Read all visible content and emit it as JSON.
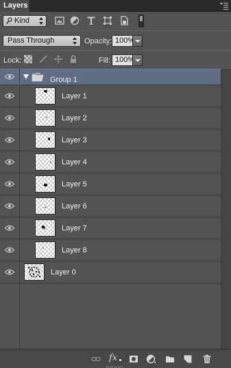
{
  "panel": {
    "tab_label": "Layers",
    "menu_icon": "panel-menu-icon"
  },
  "filter": {
    "kind_label": "Kind",
    "icons": [
      "pixel-layer-filter-icon",
      "adjustment-layer-filter-icon",
      "type-layer-filter-icon",
      "shape-layer-filter-icon",
      "smart-object-filter-icon"
    ]
  },
  "blend": {
    "mode": "Pass Through",
    "opacity_label": "Opacity:",
    "opacity_value": "100%"
  },
  "lock": {
    "label": "Lock:",
    "icons": [
      "lock-transparent-pixels-icon",
      "lock-image-pixels-icon",
      "lock-position-icon",
      "lock-all-icon"
    ],
    "fill_label": "Fill:",
    "fill_value": "100%"
  },
  "layers": {
    "group": {
      "name": "Group 1",
      "visible": true,
      "expanded": true
    },
    "children": [
      {
        "name": "Layer 1",
        "visible": true
      },
      {
        "name": "Layer 2",
        "visible": true
      },
      {
        "name": "Layer 3",
        "visible": true
      },
      {
        "name": "Layer 4",
        "visible": true
      },
      {
        "name": "Layer 5",
        "visible": true
      },
      {
        "name": "Layer 6",
        "visible": true
      },
      {
        "name": "Layer 7",
        "visible": true
      },
      {
        "name": "Layer 8",
        "visible": true
      }
    ],
    "bottom": {
      "name": "Layer 0",
      "visible": true
    }
  },
  "footer": {
    "icons": [
      "link-layers-icon",
      "layer-style-fx-icon",
      "add-mask-icon",
      "adjustment-layer-icon",
      "new-group-icon",
      "new-layer-icon",
      "delete-layer-icon"
    ],
    "fx_label": "fx"
  },
  "colors": {
    "selected_row": "#5f6e83",
    "panel_bg": "#535353"
  }
}
